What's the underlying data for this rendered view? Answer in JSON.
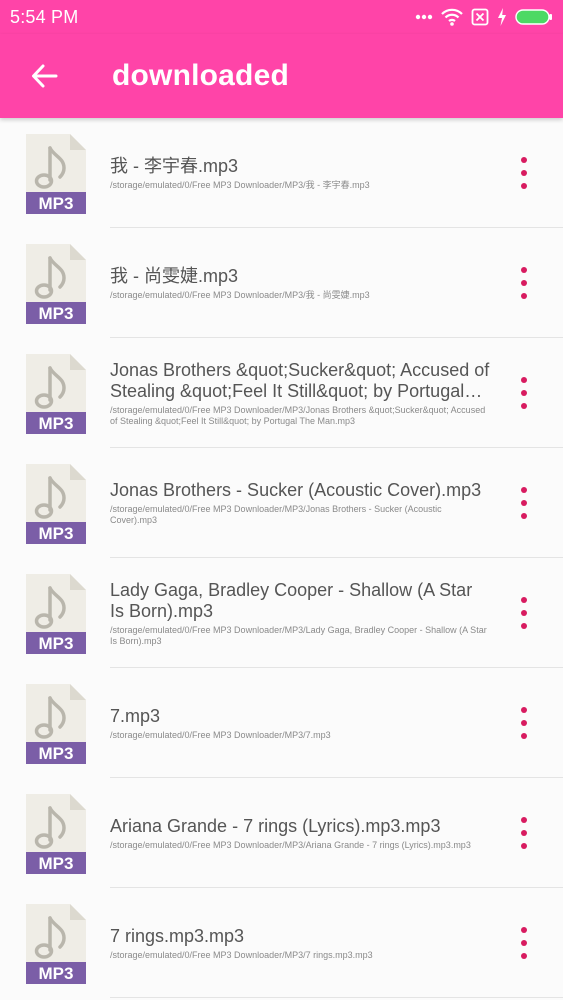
{
  "status_bar": {
    "time": "5:54 PM"
  },
  "app_bar": {
    "title": "downloaded",
    "back_icon": "arrow-left-icon"
  },
  "colors": {
    "primary": "#ff44a8",
    "accent_dots": "#d81b60",
    "mp3_label_bg": "#7b5ea7",
    "file_paper": "#efede6",
    "battery": "#4cd964"
  },
  "file_icon": {
    "label": "MP3",
    "icon": "mp3-file-icon"
  },
  "files": [
    {
      "name": "我 - 李宇春.mp3",
      "path": "/storage/emulated/0/Free MP3 Downloader/MP3/我 - 李宇春.mp3"
    },
    {
      "name": "我 - 尚雯婕.mp3",
      "path": "/storage/emulated/0/Free MP3 Downloader/MP3/我 - 尚雯婕.mp3"
    },
    {
      "name": "Jonas Brothers &quot;Sucker&quot; Accused of Stealing &quot;Feel It Still&quot; by Portugal The Man.mp3",
      "path": "/storage/emulated/0/Free MP3 Downloader/MP3/Jonas Brothers &quot;Sucker&quot; Accused of Stealing &quot;Feel It Still&quot; by Portugal The Man.mp3"
    },
    {
      "name": "Jonas Brothers - Sucker (Acoustic Cover).mp3",
      "path": "/storage/emulated/0/Free MP3 Downloader/MP3/Jonas Brothers - Sucker (Acoustic Cover).mp3"
    },
    {
      "name": "Lady Gaga, Bradley Cooper - Shallow (A Star Is Born).mp3",
      "path": "/storage/emulated/0/Free MP3 Downloader/MP3/Lady Gaga, Bradley Cooper - Shallow (A Star Is Born).mp3"
    },
    {
      "name": "7.mp3",
      "path": "/storage/emulated/0/Free MP3 Downloader/MP3/7.mp3"
    },
    {
      "name": "Ariana Grande - 7 rings (Lyrics).mp3.mp3",
      "path": "/storage/emulated/0/Free MP3 Downloader/MP3/Ariana Grande - 7 rings (Lyrics).mp3.mp3"
    },
    {
      "name": "7 rings.mp3.mp3",
      "path": "/storage/emulated/0/Free MP3 Downloader/MP3/7 rings.mp3.mp3"
    }
  ]
}
